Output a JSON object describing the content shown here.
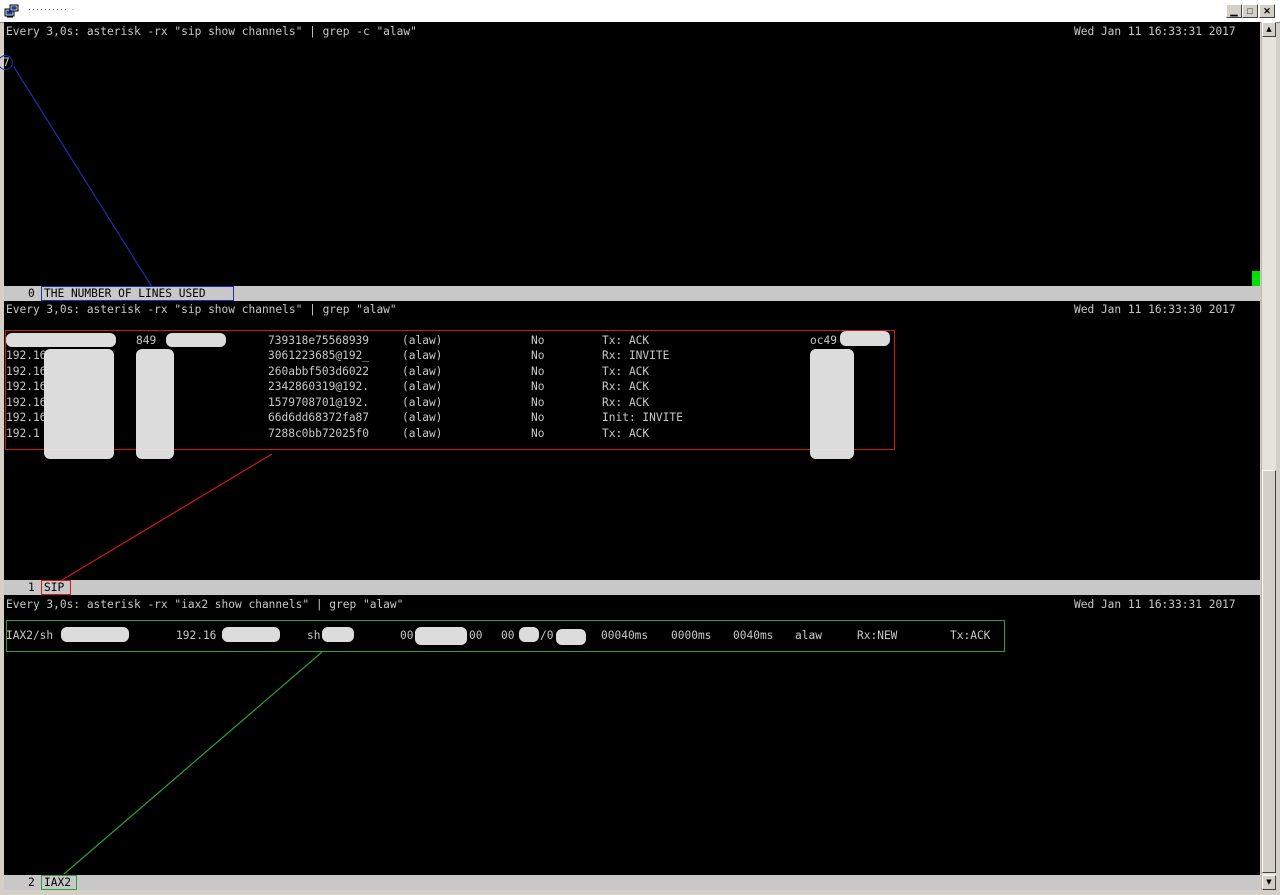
{
  "window": {
    "title": "··········  ·"
  },
  "panes": [
    {
      "command": "Every 3,0s: asterisk -rx \"sip show channels\" | grep -c \"alaw\"",
      "timestamp": "Wed Jan 11 16:33:31 2017",
      "output": "7",
      "status_num": "0",
      "status_label": "THE NUMBER OF LINES USED"
    },
    {
      "command": "Every 3,0s: asterisk -rx \"sip show channels\" | grep \"alaw\"",
      "timestamp": "Wed Jan 11 16:33:30 2017",
      "status_num": "1",
      "status_label": "SIP",
      "rows": [
        {
          "host": "",
          "user": "849",
          "callid": "739318e75568939",
          "format": "(alaw)",
          "hold": "No",
          "last_msg": "Tx: ACK",
          "expiry": "oc49"
        },
        {
          "host": "192.16",
          "user": "",
          "callid": "3061223685@192_",
          "format": "(alaw)",
          "hold": "No",
          "last_msg": "Rx: INVITE",
          "expiry": ""
        },
        {
          "host": "192.16",
          "user": "",
          "callid": "260abbf503d6022",
          "format": "(alaw)",
          "hold": "No",
          "last_msg": "Tx: ACK",
          "expiry": ""
        },
        {
          "host": "192.16",
          "user": "",
          "callid": "2342860319@192.",
          "format": "(alaw)",
          "hold": "No",
          "last_msg": "Rx: ACK",
          "expiry": ""
        },
        {
          "host": "192.16",
          "user": "",
          "callid": "1579708701@192.",
          "format": "(alaw)",
          "hold": "No",
          "last_msg": "Rx: ACK",
          "expiry": ""
        },
        {
          "host": "192.16",
          "user": "",
          "callid": "66d6dd68372fa87",
          "format": "(alaw)",
          "hold": "No",
          "last_msg": "Init: INVITE",
          "expiry": ""
        },
        {
          "host": "192.1",
          "user": "",
          "callid": "7288c0bb72025f0",
          "format": "(alaw)",
          "hold": "No",
          "last_msg": "Tx: ACK",
          "expiry": ""
        }
      ]
    },
    {
      "command": "Every 3,0s: asterisk -rx \"iax2 show channels\" | grep \"alaw\"",
      "timestamp": "Wed Jan 11 16:33:31 2017",
      "status_num": "2",
      "status_label": "IAX2",
      "row": {
        "channel": "IAX2/sh",
        "peer": "192.16",
        "username": "sh",
        "id": "00",
        "id_tail": "00",
        "seq": "00",
        "seq_tail": "/0",
        "lag": "00040ms",
        "jitter": "0000ms",
        "jitbuf": "0040ms",
        "format": "alaw",
        "first_msg": "Rx:NEW",
        "last_msg": "Tx:ACK"
      }
    }
  ],
  "colors": {
    "pane1_box": "#1a2fb0",
    "pane2_box": "#d01818",
    "pane3_box": "#2aa040",
    "status_bg": "#c8c8c8"
  }
}
